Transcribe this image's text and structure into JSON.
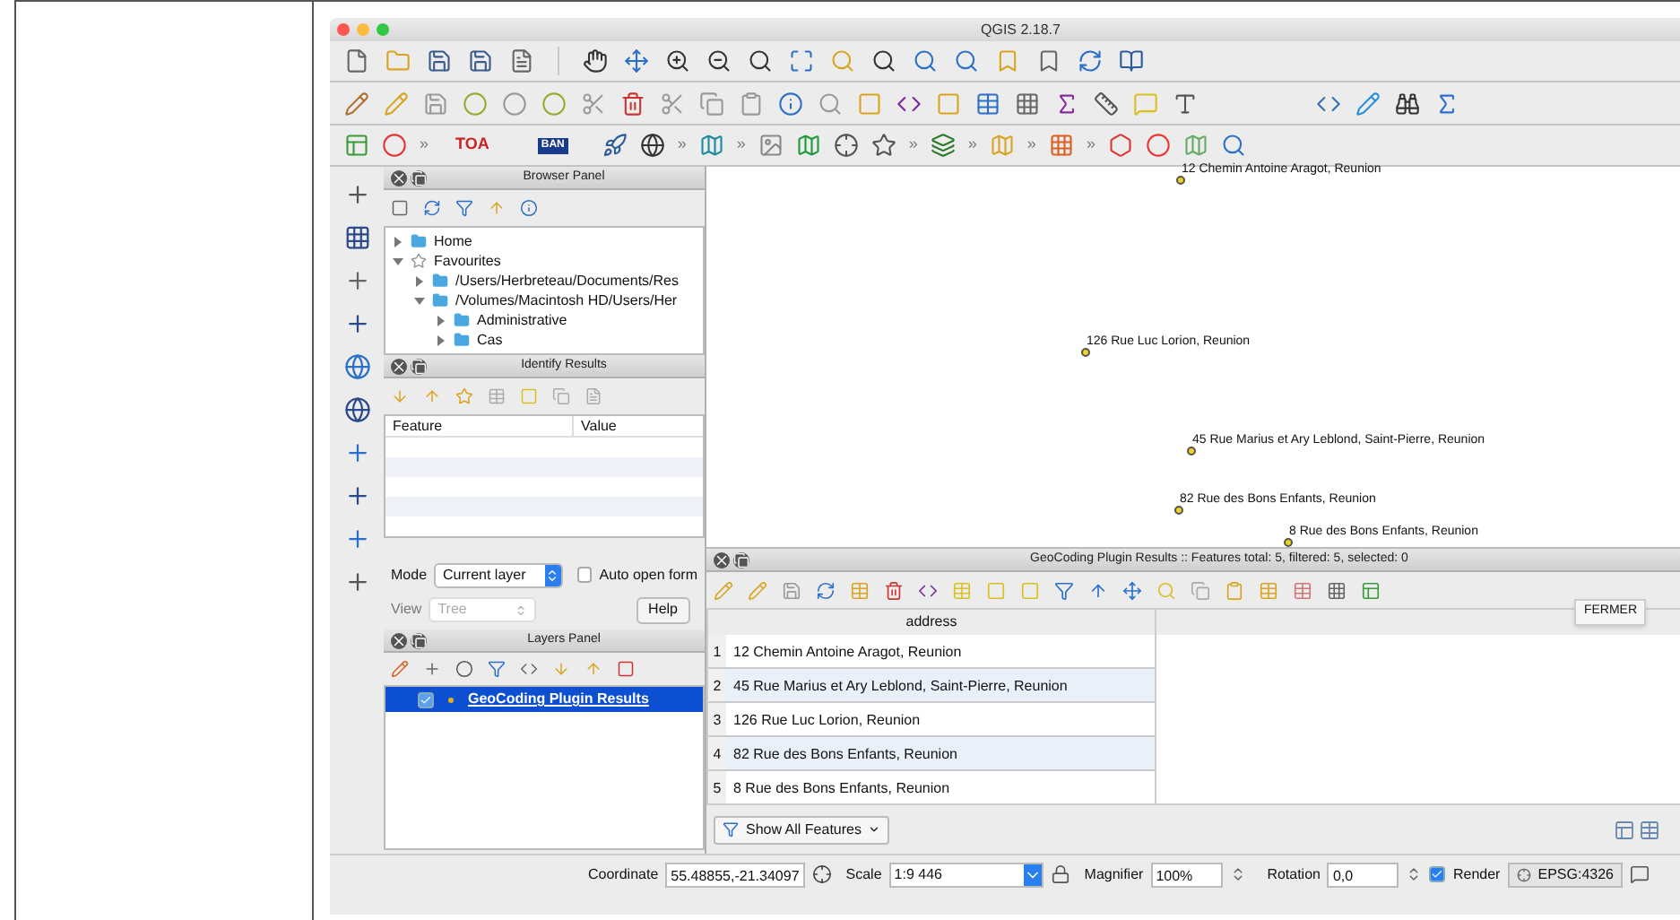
{
  "window": {
    "title": "QGIS 2.18.7"
  },
  "toolbar_3": [
    {
      "kind": "icon"
    },
    {
      "kind": "icon"
    },
    {
      "kind": "more",
      "text": "»"
    },
    {
      "kind": "label",
      "text": "TOA"
    },
    {
      "kind": "badge",
      "text": "BAN"
    },
    {
      "kind": "icon"
    },
    {
      "kind": "icon"
    },
    {
      "kind": "more",
      "text": "»"
    },
    {
      "kind": "icon"
    },
    {
      "kind": "more",
      "text": "»"
    },
    {
      "kind": "icon"
    },
    {
      "kind": "icon"
    },
    {
      "kind": "icon"
    },
    {
      "kind": "icon"
    },
    {
      "kind": "more",
      "text": "»"
    },
    {
      "kind": "icon"
    },
    {
      "kind": "more",
      "text": "»"
    },
    {
      "kind": "icon"
    },
    {
      "kind": "more",
      "text": "»"
    },
    {
      "kind": "icon"
    },
    {
      "kind": "more",
      "text": "»"
    },
    {
      "kind": "icon"
    },
    {
      "kind": "icon"
    },
    {
      "kind": "icon"
    },
    {
      "kind": "icon"
    }
  ],
  "browser_panel": {
    "title": "Browser Panel",
    "tree": [
      {
        "label": "Home",
        "expanded": false,
        "kind": "folder"
      },
      {
        "label": "Favourites",
        "expanded": true,
        "kind": "star",
        "children": [
          {
            "label": "/Users/Herbreteau/Documents/Res",
            "expanded": false,
            "kind": "folder"
          },
          {
            "label": "/Volumes/Macintosh HD/Users/Her",
            "expanded": true,
            "kind": "folder",
            "children": [
              {
                "label": "Administrative",
                "expanded": false,
                "kind": "folder"
              },
              {
                "label": "Cas",
                "expanded": false,
                "kind": "folder"
              }
            ]
          }
        ]
      }
    ]
  },
  "identify_results": {
    "title": "Identify Results",
    "columns": [
      "Feature",
      "Value"
    ],
    "mode": {
      "label": "Mode",
      "value": "Current layer"
    },
    "auto_open": {
      "label": "Auto open form",
      "checked": false
    },
    "view": {
      "label": "View",
      "value": "Tree",
      "disabled": true
    },
    "help_button": "Help"
  },
  "layers_panel": {
    "title": "Layers Panel",
    "layers": [
      {
        "name": "GeoCoding Plugin Results",
        "checked": true,
        "selected": true
      }
    ]
  },
  "map": {
    "labels": [
      "12 Chemin Antoine Aragot, Reunion",
      "126 Rue Luc Lorion, Reunion",
      "45 Rue Marius et Ary Leblond, Saint-Pierre, Reunion",
      "82 Rue des Bons Enfants, Reunion",
      "8 Rue des Bons Enfants, Reunion"
    ]
  },
  "attribute_table": {
    "title": "GeoCoding Plugin Results :: Features total: 5, filtered: 5, selected: 0",
    "tooltip": "FERMER",
    "columns": [
      "address"
    ],
    "rows": [
      {
        "index": "1",
        "address": "12 Chemin Antoine Aragot, Reunion"
      },
      {
        "index": "2",
        "address": "45 Rue Marius et Ary Leblond, Saint-Pierre, Reunion"
      },
      {
        "index": "3",
        "address": "126 Rue Luc Lorion, Reunion"
      },
      {
        "index": "4",
        "address": "82 Rue des Bons Enfants, Reunion"
      },
      {
        "index": "5",
        "address": "8 Rue des Bons Enfants, Reunion"
      }
    ],
    "filter_button": "Show All Features"
  },
  "status_bar": {
    "coordinate_label": "Coordinate",
    "coordinate": "55.48855,-21.34097",
    "scale_label": "Scale",
    "scale": "1:9 446",
    "magnifier_label": "Magnifier",
    "magnifier": "100%",
    "rotation_label": "Rotation",
    "rotation": "0,0",
    "render": {
      "label": "Render",
      "checked": true
    },
    "crs": "EPSG:4326"
  }
}
